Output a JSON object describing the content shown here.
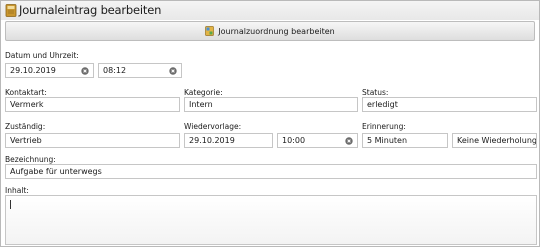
{
  "window": {
    "title": "Journaleintrag bearbeiten",
    "icon": "journal-book-icon"
  },
  "toolbar": {
    "assign_label": "Journalzuordnung bearbeiten",
    "assign_icon": "journal-assign-icon"
  },
  "form": {
    "datetime_label": "Datum und Uhrzeit:",
    "date_value": "29.10.2019",
    "time_value": "08:12",
    "contact_type_label": "Kontaktart:",
    "contact_type_value": "Vermerk",
    "category_label": "Kategorie:",
    "category_value": "Intern",
    "status_label": "Status:",
    "status_value": "erledigt",
    "responsible_label": "Zuständig:",
    "responsible_value": "Vertrieb",
    "followup_label": "Wiedervorlage:",
    "followup_date_value": "29.10.2019",
    "followup_time_value": "10:00",
    "reminder_label": "Erinnerung:",
    "reminder_value": "5 Minuten",
    "repeat_value": "Keine Wiederholung",
    "designation_label": "Bezeichnung:",
    "designation_value": "Aufgabe für unterwegs",
    "content_label": "Inhalt:",
    "content_value": ""
  },
  "icons": {
    "clear": "clear-circle-x-icon"
  },
  "colors": {
    "border": "#c6c6c6",
    "toolbar_bg": "#e6e6e6",
    "titlebar_bg": "#eeeeee",
    "text": "#1a1a1a"
  }
}
